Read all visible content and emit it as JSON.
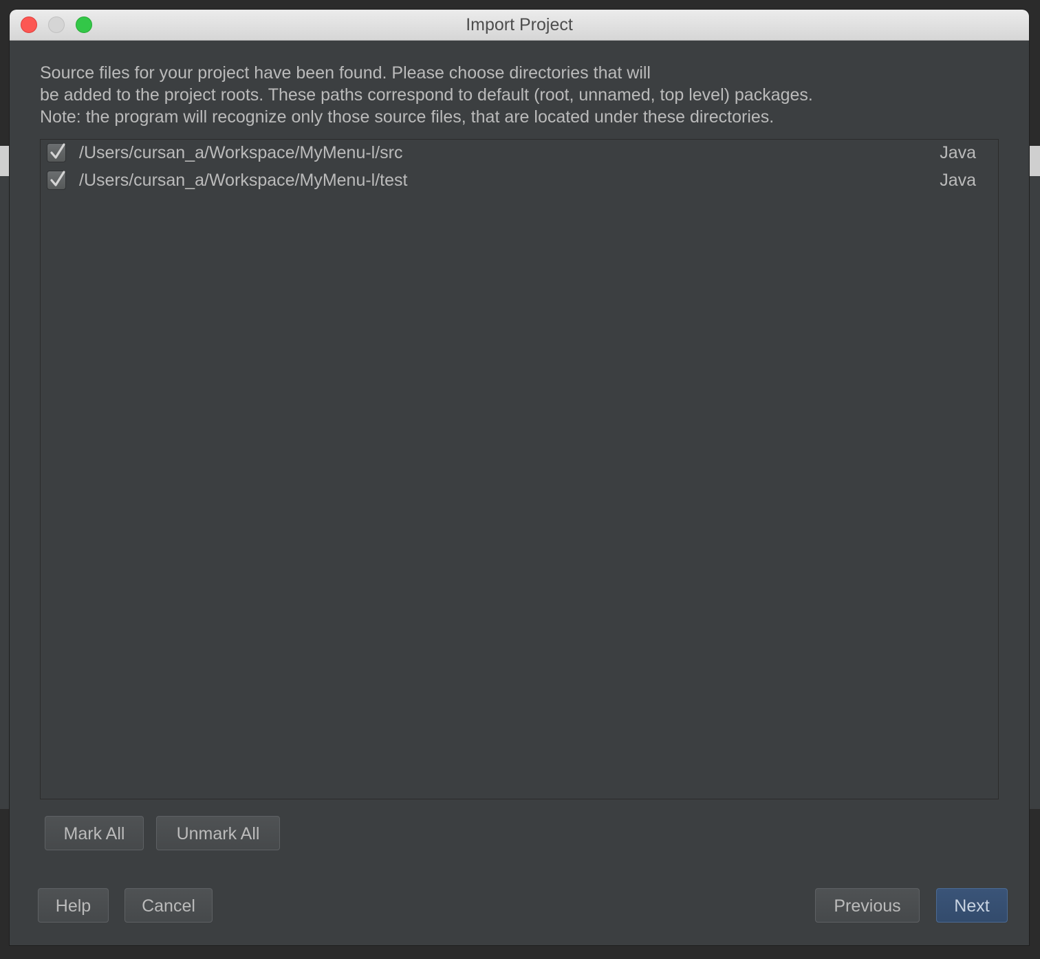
{
  "window": {
    "title": "Import Project"
  },
  "description": {
    "lines": [
      "Source files for your project have been found. Please choose directories that will",
      "be added to the project roots. These paths correspond to default (root, unnamed, top level) packages.",
      "Note: the program will recognize only those source files, that are located under these directories."
    ]
  },
  "roots": [
    {
      "checked": true,
      "path": "/Users/cursan_a/Workspace/MyMenu-l/src",
      "language": "Java"
    },
    {
      "checked": true,
      "path": "/Users/cursan_a/Workspace/MyMenu-l/test",
      "language": "Java"
    }
  ],
  "list_actions": {
    "mark_all": "Mark All",
    "unmark_all": "Unmark All"
  },
  "footer": {
    "help": "Help",
    "cancel": "Cancel",
    "previous": "Previous",
    "next": "Next"
  },
  "colors": {
    "dialog_bg": "#3c3f41",
    "text": "#bbbbbb",
    "default_button": "#365880",
    "close": "#fc5753",
    "minimize": "#d5d5d5",
    "maximize": "#33c748"
  },
  "icons": {
    "checkbox": "checkmark-icon"
  }
}
